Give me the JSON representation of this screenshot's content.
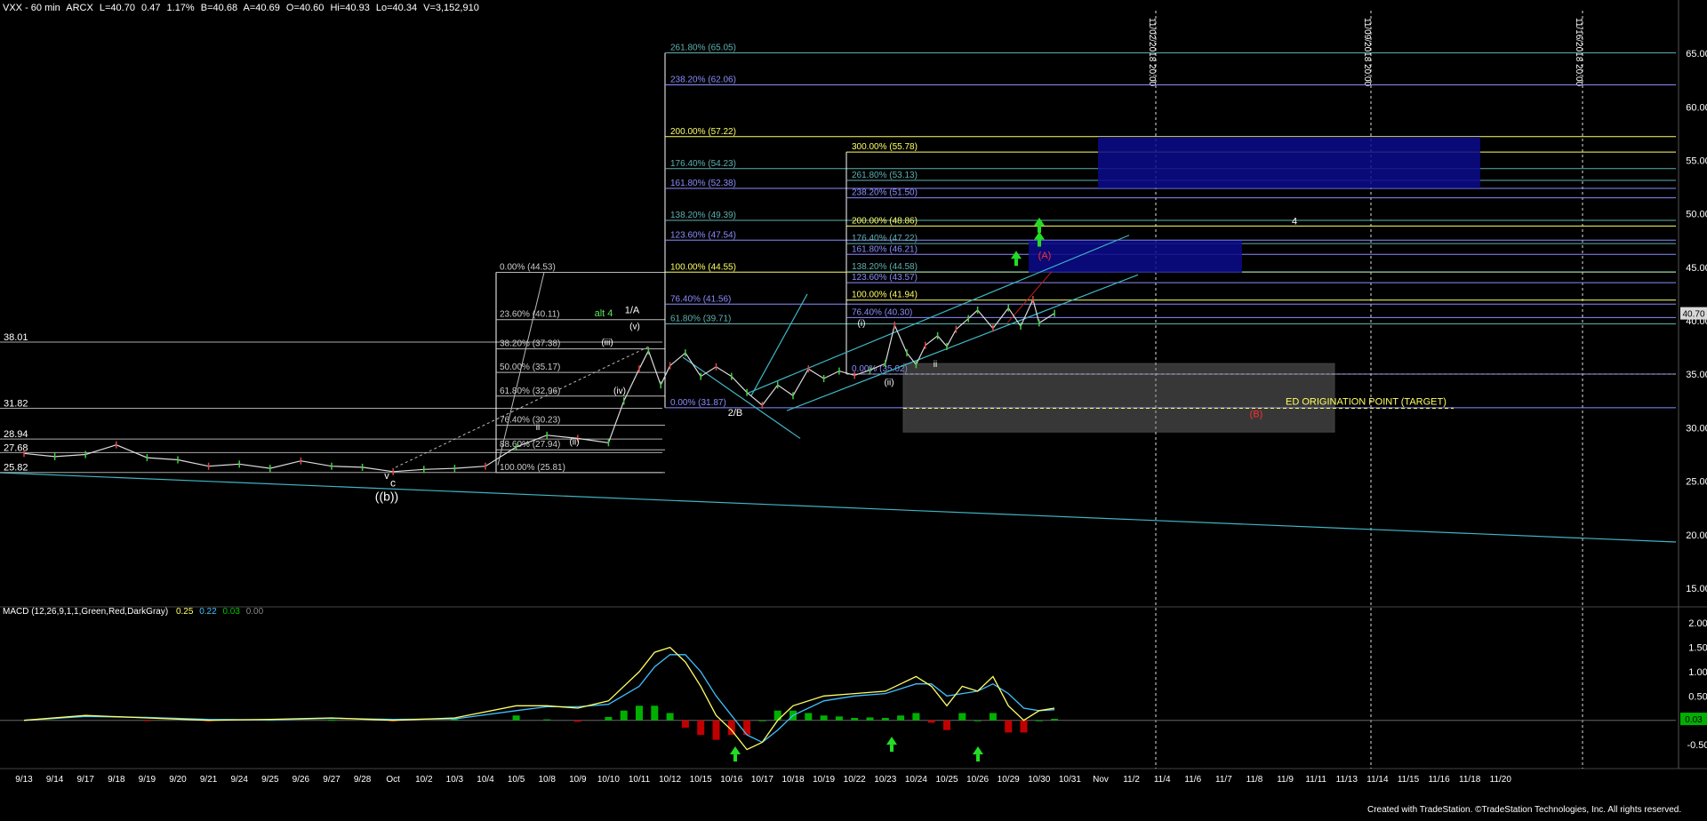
{
  "header": {
    "symbol": "VXX - 60 min",
    "exchange": "ARCX",
    "last": "L=40.70",
    "change": "0.47",
    "change_pct": "1.17%",
    "bid": "B=40.68",
    "ask": "A=40.69",
    "open": "O=40.60",
    "high": "Hi=40.93",
    "low": "Lo=40.34",
    "volume": "V=3,152,910"
  },
  "macd_header": {
    "label": "MACD (12,26,9,1,1,Green,Red,DarkGray)",
    "v1": "0.25",
    "v2": "0.22",
    "v3": "0.03",
    "v4": "0.00"
  },
  "footer": "Created with TradeStation. ©TradeStation Technologies, Inc. All rights reserved.",
  "colors": {
    "background": "#000000",
    "price": "#dcdcdc",
    "yellow": "#ffff66",
    "blue_fib": "#8c8cff",
    "teal_fib": "#5fb0b0",
    "channel": "#3fb6c6",
    "macd_up": "#00b000",
    "macd_down": "#c00000",
    "green_arrow": "#22dd22",
    "target_box": "#0a0a8c"
  },
  "chart_data": [
    {
      "type": "line",
      "title": "VXX - 60 min",
      "ylim": [
        13.5,
        69.0
      ],
      "yticks": [
        "65.00",
        "60.00",
        "55.00",
        "50.00",
        "45.00",
        "40.00",
        "35.00",
        "30.00",
        "25.00",
        "20.00",
        "15.00"
      ],
      "ytick_values": [
        65,
        60,
        55,
        50,
        45,
        40,
        35,
        30,
        25,
        20,
        15
      ],
      "last_price_tag": "40.70",
      "last_price": 40.7,
      "x_labels": [
        "9/13",
        "9/14",
        "9/17",
        "9/18",
        "9/19",
        "9/20",
        "9/21",
        "9/24",
        "9/25",
        "9/26",
        "9/27",
        "9/28",
        "Oct",
        "10/2",
        "10/3",
        "10/4",
        "10/5",
        "10/8",
        "10/9",
        "10/10",
        "10/11",
        "10/12",
        "10/15",
        "10/16",
        "10/17",
        "10/18",
        "10/19",
        "10/22",
        "10/23",
        "10/24",
        "10/25",
        "10/26",
        "10/29",
        "10/30",
        "10/31",
        "Nov",
        "11/2",
        "11/4",
        "11/6",
        "11/7",
        "11/8",
        "11/9",
        "11/11",
        "11/13",
        "11/14",
        "11/15",
        "11/16",
        "11/18",
        "11/20"
      ],
      "price_series": {
        "x": [
          0,
          1,
          2,
          3,
          4,
          5,
          6,
          7,
          8,
          9,
          10,
          11,
          12,
          13,
          14,
          15,
          16,
          17,
          18,
          19,
          19.5,
          20,
          20.3,
          20.7,
          21,
          21.5,
          22,
          22.5,
          23,
          23.5,
          24,
          24.5,
          25,
          25.5,
          26,
          26.5,
          27,
          27.5,
          28,
          28.3,
          28.7,
          29,
          29.3,
          29.7,
          30,
          30.3,
          30.7,
          31,
          31.5,
          32,
          32.4,
          32.8,
          33,
          33.5
        ],
        "y": [
          27.6,
          27.3,
          27.5,
          28.4,
          27.2,
          27.0,
          26.4,
          26.6,
          26.2,
          26.9,
          26.4,
          26.3,
          25.9,
          26.1,
          26.2,
          26.4,
          28.2,
          29.3,
          29.0,
          28.6,
          32.5,
          35.5,
          37.2,
          34.0,
          35.8,
          37.0,
          34.8,
          35.7,
          34.8,
          33.3,
          32.1,
          34.0,
          33.0,
          35.5,
          34.6,
          35.3,
          34.9,
          35.4,
          36.0,
          39.6,
          37.0,
          35.9,
          37.7,
          38.6,
          37.6,
          39.2,
          40.2,
          41.0,
          39.3,
          41.2,
          39.5,
          42.0,
          39.8,
          40.7
        ]
      },
      "horizontal_levels": [
        {
          "label": "38.01",
          "value": 38.01
        },
        {
          "label": "31.82",
          "value": 31.82
        },
        {
          "label": "28.94",
          "value": 28.94
        },
        {
          "label": "27.68",
          "value": 27.68
        },
        {
          "label": "25.82",
          "value": 25.82
        }
      ],
      "fib_set_a": [
        {
          "label": "0.00% (44.53)",
          "value": 44.53
        },
        {
          "label": "23.60% (40.11)",
          "value": 40.11
        },
        {
          "label": "38.20% (37.38)",
          "value": 37.38
        },
        {
          "label": "50.00% (35.17)",
          "value": 35.17
        },
        {
          "label": "61.80% (32.96)",
          "value": 32.96
        },
        {
          "label": "76.40% (30.23)",
          "value": 30.23
        },
        {
          "label": "88.60% (27.94)",
          "value": 27.94
        },
        {
          "label": "100.00% (25.81)",
          "value": 25.81
        }
      ],
      "fib_set_b": [
        {
          "label": "261.80% (65.05)",
          "value": 65.05
        },
        {
          "label": "238.20% (62.06)",
          "value": 62.06
        },
        {
          "label": "200.00% (57.22)",
          "value": 57.22
        },
        {
          "label": "176.40% (54.23)",
          "value": 54.23
        },
        {
          "label": "161.80% (52.38)",
          "value": 52.38
        },
        {
          "label": "138.20% (49.39)",
          "value": 49.39
        },
        {
          "label": "123.60% (47.54)",
          "value": 47.54
        },
        {
          "label": "100.00% (44.55)",
          "value": 44.55
        },
        {
          "label": "76.40% (41.56)",
          "value": 41.56
        },
        {
          "label": "61.80% (39.71)",
          "value": 39.71
        },
        {
          "label": "0.00% (31.87)",
          "value": 31.87
        }
      ],
      "fib_set_c": [
        {
          "label": "300.00% (55.78)",
          "value": 55.78
        },
        {
          "label": "261.80% (53.13)",
          "value": 53.13
        },
        {
          "label": "238.20% (51.50)",
          "value": 51.5
        },
        {
          "label": "200.00% (48.86)",
          "value": 48.86
        },
        {
          "label": "176.40% (47.22)",
          "value": 47.22
        },
        {
          "label": "161.80% (46.21)",
          "value": 46.21
        },
        {
          "label": "138.20% (44.58)",
          "value": 44.58
        },
        {
          "label": "123.60% (43.57)",
          "value": 43.57
        },
        {
          "label": "100.00% (41.94)",
          "value": 41.94
        },
        {
          "label": "76.40% (40.30)",
          "value": 40.3
        },
        {
          "label": "0.00% (35.02)",
          "value": 35.02
        }
      ],
      "vertical_markers": [
        {
          "label": "11/02/2018 20:00"
        },
        {
          "label": "11/09/2018 20:00"
        },
        {
          "label": "11/16/2018 20:00"
        }
      ],
      "target_text": "ED ORIGINATION POINT (TARGET)",
      "wave_labels": {
        "b": "((b))",
        "c": "c",
        "v": "v",
        "ii": "(ii)",
        "ii_sub": "ii",
        "iii": "(iii)",
        "iv": "(iv)",
        "v_paren": "(v)",
        "one_a": "1/A",
        "alt4": "alt 4",
        "two_b": "2/B",
        "i": "(i)",
        "ii_b": "(ii)",
        "A": "(A)",
        "B": "(B)",
        "four": "4",
        "ii_small": "ii"
      }
    },
    {
      "type": "bar",
      "title": "MACD (12,26,9,1,1,Green,Red,DarkGray)",
      "ylim": [
        -0.9,
        2.15
      ],
      "yticks": [
        "2.00",
        "1.50",
        "1.00",
        "0.50",
        "0.00",
        "-0.50"
      ],
      "ytick_values": [
        2.0,
        1.5,
        1.0,
        0.5,
        0.0,
        -0.5
      ],
      "last_value_tag": "0.03",
      "macd_line": {
        "x": [
          0,
          2,
          4,
          6,
          8,
          10,
          12,
          14,
          16,
          17,
          18,
          19,
          20,
          20.5,
          21,
          21.5,
          22,
          22.5,
          23,
          23.5,
          24,
          24.5,
          25,
          26,
          27,
          28,
          29,
          29.5,
          30,
          30.5,
          31,
          31.5,
          32,
          32.5,
          33,
          33.5
        ],
        "y": [
          0.0,
          0.1,
          0.05,
          0.0,
          0.02,
          0.05,
          0.0,
          0.05,
          0.3,
          0.3,
          0.25,
          0.4,
          1.0,
          1.4,
          1.5,
          1.2,
          0.7,
          0.1,
          -0.2,
          -0.6,
          -0.45,
          0.0,
          0.3,
          0.5,
          0.55,
          0.6,
          0.9,
          0.7,
          0.3,
          0.7,
          0.6,
          0.9,
          0.3,
          0.0,
          0.2,
          0.25
        ]
      },
      "signal_line": {
        "x": [
          0,
          2,
          4,
          6,
          8,
          10,
          12,
          14,
          16,
          17,
          18,
          19,
          20,
          20.5,
          21,
          21.5,
          22,
          22.5,
          23,
          23.5,
          24,
          24.5,
          25,
          26,
          27,
          28,
          29,
          29.5,
          30,
          30.5,
          31,
          31.5,
          32,
          32.5,
          33,
          33.5
        ],
        "y": [
          0.0,
          0.08,
          0.06,
          0.02,
          0.01,
          0.04,
          0.02,
          0.03,
          0.2,
          0.28,
          0.28,
          0.33,
          0.7,
          1.1,
          1.35,
          1.35,
          1.0,
          0.5,
          0.1,
          -0.3,
          -0.45,
          -0.2,
          0.1,
          0.4,
          0.5,
          0.55,
          0.75,
          0.75,
          0.5,
          0.55,
          0.6,
          0.75,
          0.55,
          0.25,
          0.2,
          0.22
        ]
      },
      "histogram_x": [
        4,
        6,
        8,
        10,
        12,
        14,
        16,
        17,
        18,
        19,
        19.5,
        20,
        20.5,
        21,
        21.5,
        22,
        22.5,
        23,
        23.5,
        24,
        24.5,
        25,
        25.5,
        26,
        26.5,
        27,
        27.5,
        28,
        28.5,
        29,
        29.5,
        30,
        30.5,
        31,
        31.5,
        32,
        32.5,
        33,
        33.5
      ],
      "histogram": [
        -0.01,
        -0.02,
        0.01,
        0.01,
        -0.02,
        0.02,
        0.1,
        0.02,
        -0.03,
        0.07,
        0.2,
        0.3,
        0.3,
        0.15,
        -0.15,
        -0.3,
        -0.4,
        -0.3,
        -0.3,
        0.0,
        0.2,
        0.2,
        0.15,
        0.1,
        0.08,
        0.05,
        0.06,
        0.05,
        0.1,
        0.15,
        -0.05,
        -0.2,
        0.15,
        0.0,
        0.15,
        -0.25,
        -0.25,
        0.0,
        0.03
      ]
    }
  ]
}
